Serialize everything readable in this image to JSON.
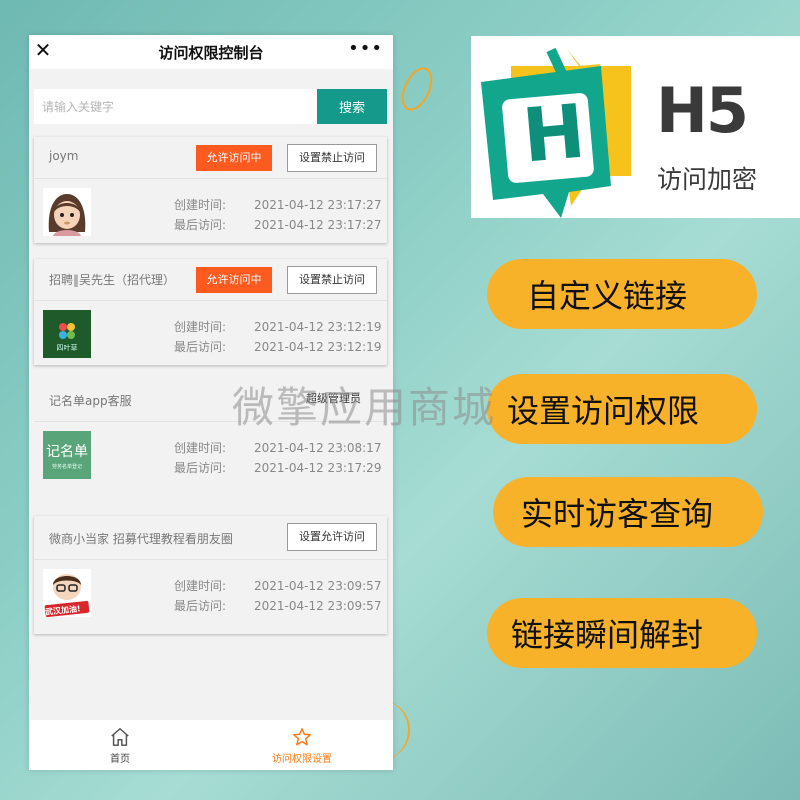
{
  "app": {
    "title": "访问权限控制台",
    "more": "•••",
    "close": "✕"
  },
  "search": {
    "placeholder": "请输入关键字",
    "button": "搜索"
  },
  "labels": {
    "created": "创建时间:",
    "last": "最后访问:"
  },
  "records": [
    {
      "name": "joym",
      "status_button": "允许访问中",
      "action_button": "设置禁止访问",
      "created": "2021-04-12 23:17:27",
      "last": "2021-04-12 23:17:27"
    },
    {
      "name": "招聘‖吴先生（招代理）",
      "status_button": "允许访问中",
      "action_button": "设置禁止访问",
      "avatar_text": "四叶草",
      "created": "2021-04-12 23:12:19",
      "last": "2021-04-12 23:12:19"
    },
    {
      "name": "记名单app客服",
      "role": "超级管理员",
      "avatar_text": "记名单",
      "avatar_sub": "劳务名单登记",
      "created": "2021-04-12 23:08:17",
      "last": "2021-04-12 23:17:29"
    },
    {
      "name": "微商小当家 招募代理教程看朋友圈",
      "action_button": "设置允许访问",
      "avatar_text": "武汉加油!",
      "created": "2021-04-12 23:09:57",
      "last": "2021-04-12 23:09:57"
    }
  ],
  "tabs": [
    {
      "label": "首页",
      "icon": "home-icon"
    },
    {
      "label": "访问权限设置",
      "icon": "star-icon"
    }
  ],
  "promo": {
    "logo_letter": "H",
    "logo_title": "H5",
    "logo_subtitle": "访问加密",
    "features": [
      "自定义链接",
      "设置访问权限",
      "实时访客查询",
      "链接瞬间解封"
    ],
    "watermark": "微擎应用商城"
  },
  "colors": {
    "accent_teal": "#15998a",
    "status_orange": "#fc5a1e",
    "pill_yellow": "#f7b22a",
    "tab_active": "#fc7a14"
  }
}
